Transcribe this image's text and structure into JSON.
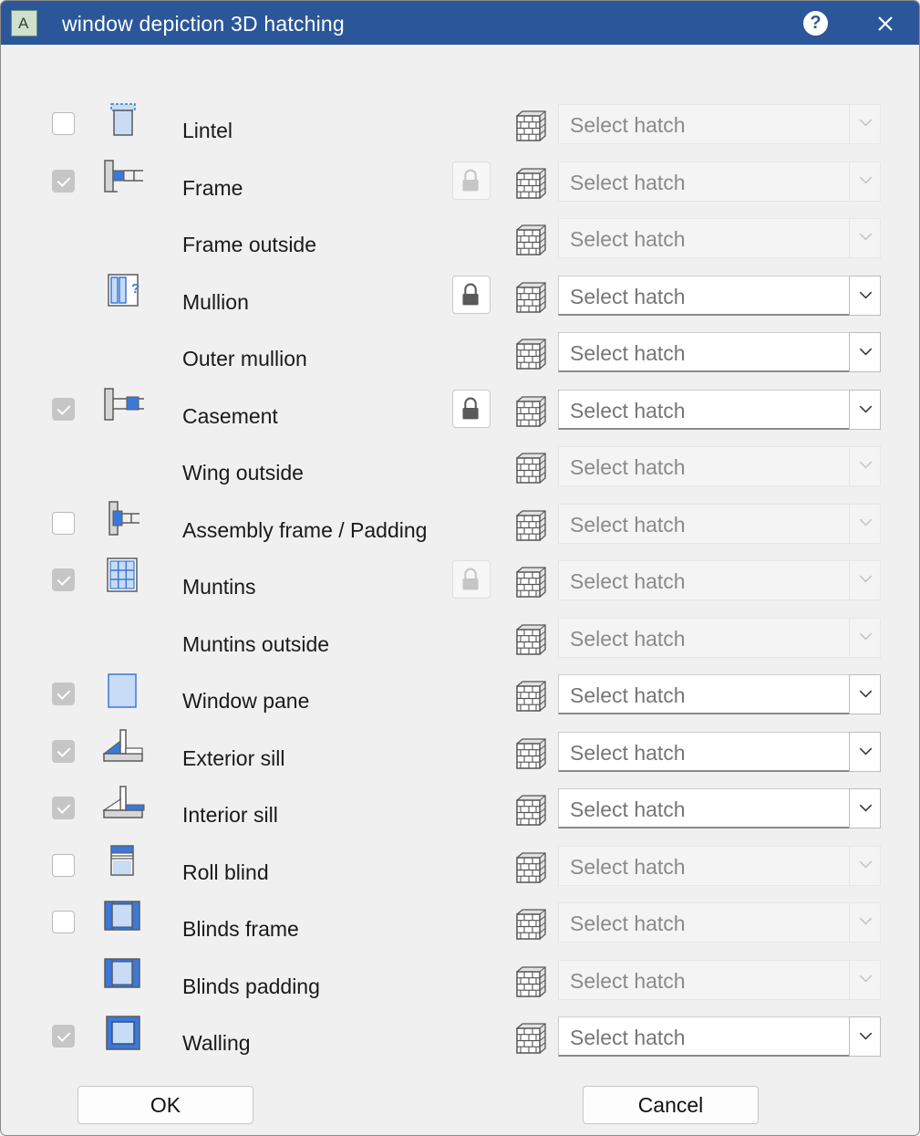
{
  "window": {
    "title": "window depiction 3D hatching",
    "app_icon_letter": "A"
  },
  "titlebar": {
    "help_icon": "question-mark-icon",
    "help_glyph": "?",
    "close_icon": "close-icon"
  },
  "rows": [
    {
      "label": "Lintel",
      "checkbox": "unchecked",
      "icon": "lintel-icon",
      "lock": "none",
      "select": {
        "placeholder": "Select hatch",
        "enabled": false
      }
    },
    {
      "label": "Frame",
      "checkbox": "checked",
      "icon": "frame-icon",
      "lock": "disabled",
      "select": {
        "placeholder": "Select hatch",
        "enabled": false
      }
    },
    {
      "label": "Frame outside",
      "checkbox": "none",
      "icon": "none",
      "lock": "none",
      "select": {
        "placeholder": "Select hatch",
        "enabled": false
      }
    },
    {
      "label": "Mullion",
      "checkbox": "none",
      "icon": "mullion-icon",
      "lock": "enabled",
      "select": {
        "placeholder": "Select hatch",
        "enabled": true
      }
    },
    {
      "label": "Outer mullion",
      "checkbox": "none",
      "icon": "none",
      "lock": "none",
      "select": {
        "placeholder": "Select hatch",
        "enabled": true
      }
    },
    {
      "label": "Casement",
      "checkbox": "checked",
      "icon": "casement-icon",
      "lock": "enabled",
      "select": {
        "placeholder": "Select hatch",
        "enabled": true
      }
    },
    {
      "label": "Wing outside",
      "checkbox": "none",
      "icon": "none",
      "lock": "none",
      "select": {
        "placeholder": "Select hatch",
        "enabled": false
      }
    },
    {
      "label": "Assembly frame / Padding",
      "checkbox": "unchecked",
      "icon": "assembly-frame-icon",
      "lock": "none",
      "select": {
        "placeholder": "Select hatch",
        "enabled": false
      }
    },
    {
      "label": "Muntins",
      "checkbox": "checked",
      "icon": "muntins-icon",
      "lock": "disabled",
      "select": {
        "placeholder": "Select hatch",
        "enabled": false
      }
    },
    {
      "label": "Muntins outside",
      "checkbox": "none",
      "icon": "none",
      "lock": "none",
      "select": {
        "placeholder": "Select hatch",
        "enabled": false
      }
    },
    {
      "label": "Window pane",
      "checkbox": "checked",
      "icon": "window-pane-icon",
      "lock": "none",
      "select": {
        "placeholder": "Select hatch",
        "enabled": true
      }
    },
    {
      "label": "Exterior sill",
      "checkbox": "checked",
      "icon": "exterior-sill-icon",
      "lock": "none",
      "select": {
        "placeholder": "Select hatch",
        "enabled": true
      }
    },
    {
      "label": "Interior sill",
      "checkbox": "checked",
      "icon": "interior-sill-icon",
      "lock": "none",
      "select": {
        "placeholder": "Select hatch",
        "enabled": true
      }
    },
    {
      "label": "Roll blind",
      "checkbox": "unchecked",
      "icon": "roll-blind-icon",
      "lock": "none",
      "select": {
        "placeholder": "Select hatch",
        "enabled": false
      }
    },
    {
      "label": "Blinds frame",
      "checkbox": "unchecked",
      "icon": "blinds-frame-icon",
      "lock": "none",
      "select": {
        "placeholder": "Select hatch",
        "enabled": false
      }
    },
    {
      "label": "Blinds padding",
      "checkbox": "none",
      "icon": "blinds-padding-icon",
      "lock": "none",
      "select": {
        "placeholder": "Select hatch",
        "enabled": false
      }
    },
    {
      "label": "Walling",
      "checkbox": "checked",
      "icon": "walling-icon",
      "lock": "none",
      "select": {
        "placeholder": "Select hatch",
        "enabled": true
      }
    }
  ],
  "hatch_icon": "brick-hatch-icon",
  "lock_icon": "padlock-icon",
  "dropdown_icon": "chevron-down-icon",
  "buttons": {
    "ok": "OK",
    "cancel": "Cancel"
  },
  "colors": {
    "titlebar": "#2b579a",
    "icon_blue": "#3b78d8",
    "icon_light_blue": "#c9dcf5"
  }
}
